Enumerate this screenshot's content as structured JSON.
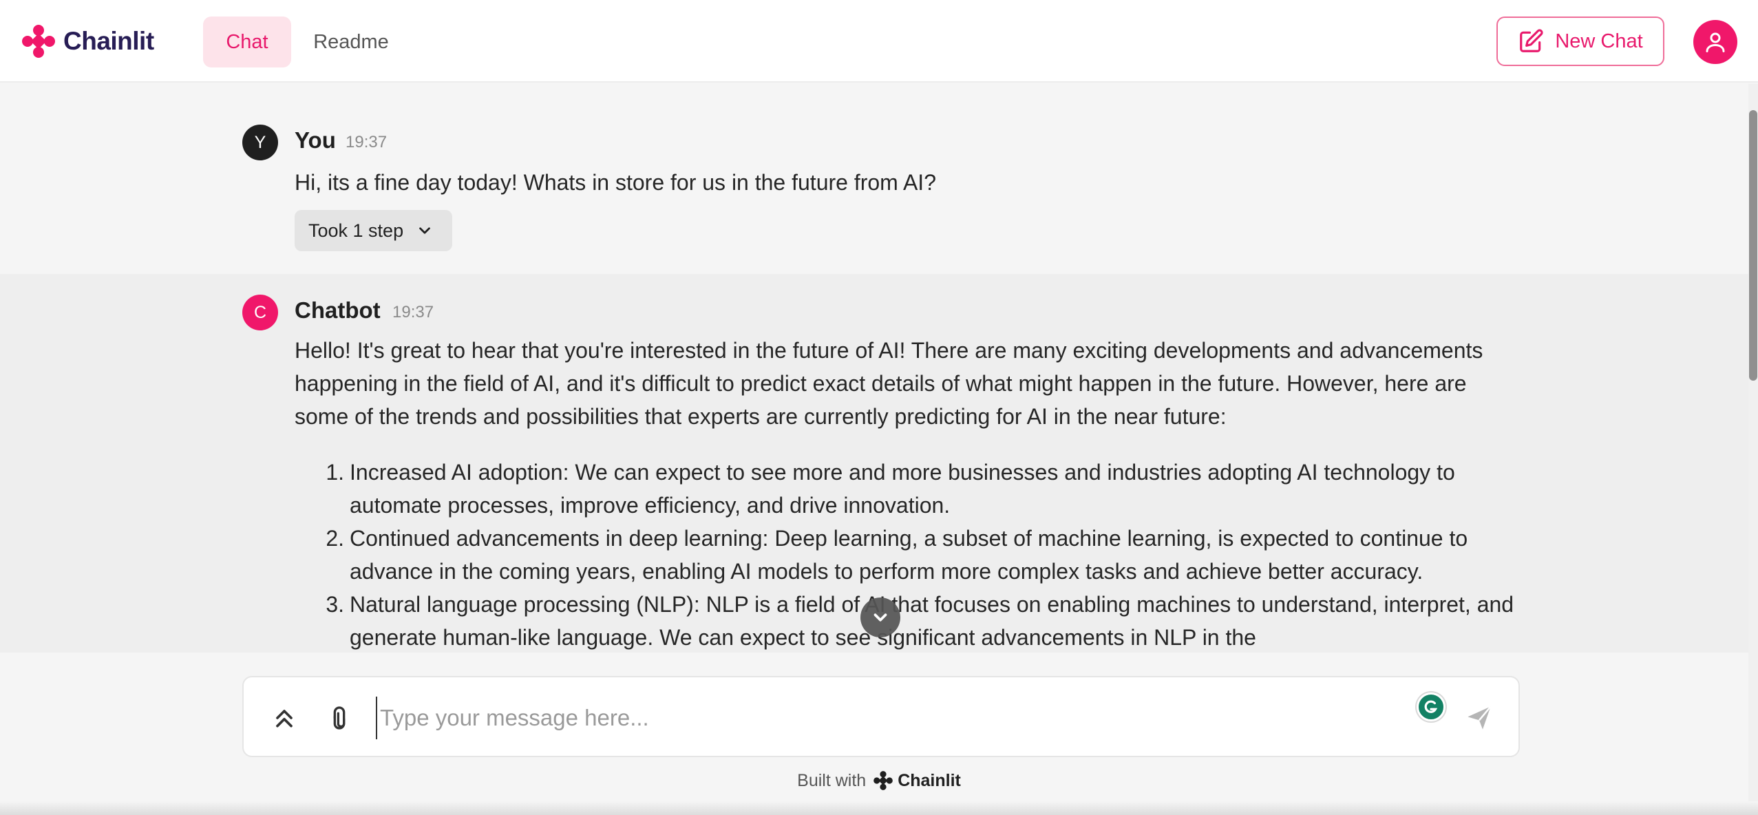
{
  "header": {
    "logo_text": "Chainlit",
    "tabs": [
      {
        "label": "Chat",
        "active": true
      },
      {
        "label": "Readme",
        "active": false
      }
    ],
    "new_chat_label": "New Chat"
  },
  "messages": [
    {
      "author": "You",
      "avatar_letter": "Y",
      "time": "19:37",
      "text": "Hi, its a fine day today! Whats in store for us in the future from AI?",
      "steps_label": "Took 1 step"
    },
    {
      "author": "Chatbot",
      "avatar_letter": "C",
      "time": "19:37",
      "paragraph": "Hello! It's great to hear that you're interested in the future of AI! There are many exciting developments and advancements happening in the field of AI, and it's difficult to predict exact details of what might happen in the future. However, here are some of the trends and possibilities that experts are currently predicting for AI in the near future:",
      "list": [
        {
          "num": "1.",
          "text": "Increased AI adoption: We can expect to see more and more businesses and industries adopting AI technology to automate processes, improve efficiency, and drive innovation."
        },
        {
          "num": "2.",
          "text": "Continued advancements in deep learning: Deep learning, a subset of machine learning, is expected to continue to advance in the coming years, enabling AI models to perform more complex tasks and achieve better accuracy."
        },
        {
          "num": "3.",
          "text": "Natural language processing (NLP): NLP is a field of AI that focuses on enabling machines to understand, interpret, and generate human-like language. We can expect to see significant advancements in NLP in the"
        }
      ]
    }
  ],
  "composer": {
    "placeholder": "Type your message here..."
  },
  "footer": {
    "prefix": "Built with",
    "brand": "Chainlit"
  },
  "colors": {
    "accent": "#f0176a",
    "logo_text": "#271d55",
    "grammarly": "#138164"
  },
  "icons": {
    "logo": "chainlit-logo-icon",
    "new_chat": "edit-icon",
    "user": "user-icon",
    "steps": "chevron-down-icon",
    "scroll": "chevron-down-icon",
    "history": "double-chevron-up-icon",
    "attach": "paperclip-icon",
    "grammarly": "grammarly-icon",
    "send": "send-icon"
  }
}
